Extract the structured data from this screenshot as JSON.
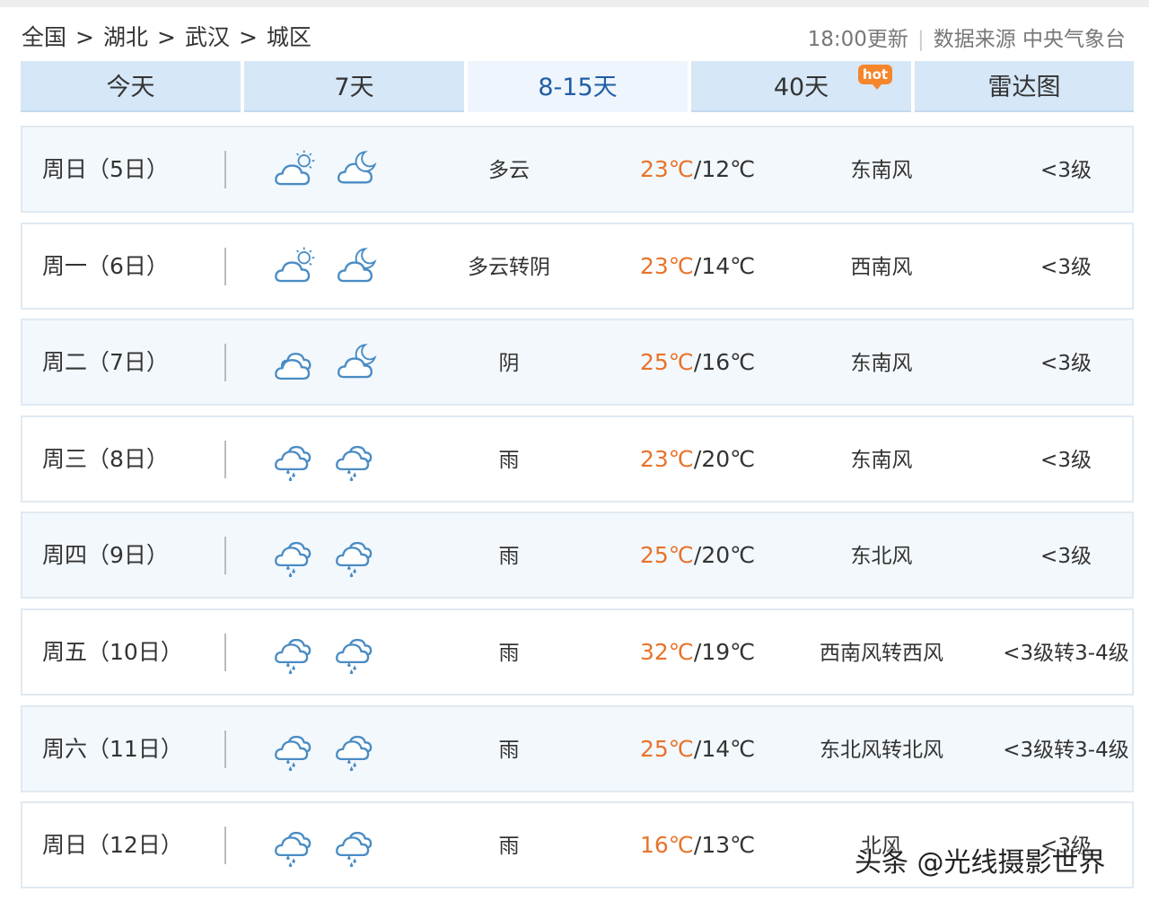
{
  "breadcrumb": [
    "全国",
    "湖北",
    "武汉",
    "城区"
  ],
  "breadcrumb_separator": ">",
  "update_time": "18:00更新",
  "data_source": "数据来源 中央气象台",
  "tabs": [
    {
      "label": "今天"
    },
    {
      "label": "7天"
    },
    {
      "label": "8-15天"
    },
    {
      "label": "40天",
      "badge": "hot"
    },
    {
      "label": "雷达图"
    }
  ],
  "active_tab": "8-15天",
  "colors": {
    "accent": "#1f5da8",
    "high_temp": "#e8732b",
    "tab_bg": "#d6e7f7",
    "icon": "#4a8cc4"
  },
  "forecast": [
    {
      "day": "周日（5日）",
      "icon_day": "partly-cloudy-day-icon",
      "icon_night": "partly-cloudy-night-icon",
      "desc": "多云",
      "high": "23℃",
      "low": "12℃",
      "wind": "东南风",
      "level": "<3级"
    },
    {
      "day": "周一（6日）",
      "icon_day": "partly-cloudy-day-icon",
      "icon_night": "cloudy-night-icon",
      "desc": "多云转阴",
      "high": "23℃",
      "low": "14℃",
      "wind": "西南风",
      "level": "<3级"
    },
    {
      "day": "周二（7日）",
      "icon_day": "overcast-icon",
      "icon_night": "cloudy-night-icon",
      "desc": "阴",
      "high": "25℃",
      "low": "16℃",
      "wind": "东南风",
      "level": "<3级"
    },
    {
      "day": "周三（8日）",
      "icon_day": "rain-icon",
      "icon_night": "rain-icon",
      "desc": "雨",
      "high": "23℃",
      "low": "20℃",
      "wind": "东南风",
      "level": "<3级"
    },
    {
      "day": "周四（9日）",
      "icon_day": "rain-icon",
      "icon_night": "rain-icon",
      "desc": "雨",
      "high": "25℃",
      "low": "20℃",
      "wind": "东北风",
      "level": "<3级"
    },
    {
      "day": "周五（10日）",
      "icon_day": "rain-icon",
      "icon_night": "rain-icon",
      "desc": "雨",
      "high": "32℃",
      "low": "19℃",
      "wind": "西南风转西风",
      "level": "<3级转3-4级"
    },
    {
      "day": "周六（11日）",
      "icon_day": "rain-icon",
      "icon_night": "rain-icon",
      "desc": "雨",
      "high": "25℃",
      "low": "14℃",
      "wind": "东北风转北风",
      "level": "<3级转3-4级"
    },
    {
      "day": "周日（12日）",
      "icon_day": "rain-icon",
      "icon_night": "rain-icon",
      "desc": "雨",
      "high": "16℃",
      "low": "13℃",
      "wind": "北风",
      "level": "<3级"
    }
  ],
  "watermark": "头条 @光线摄影世界"
}
